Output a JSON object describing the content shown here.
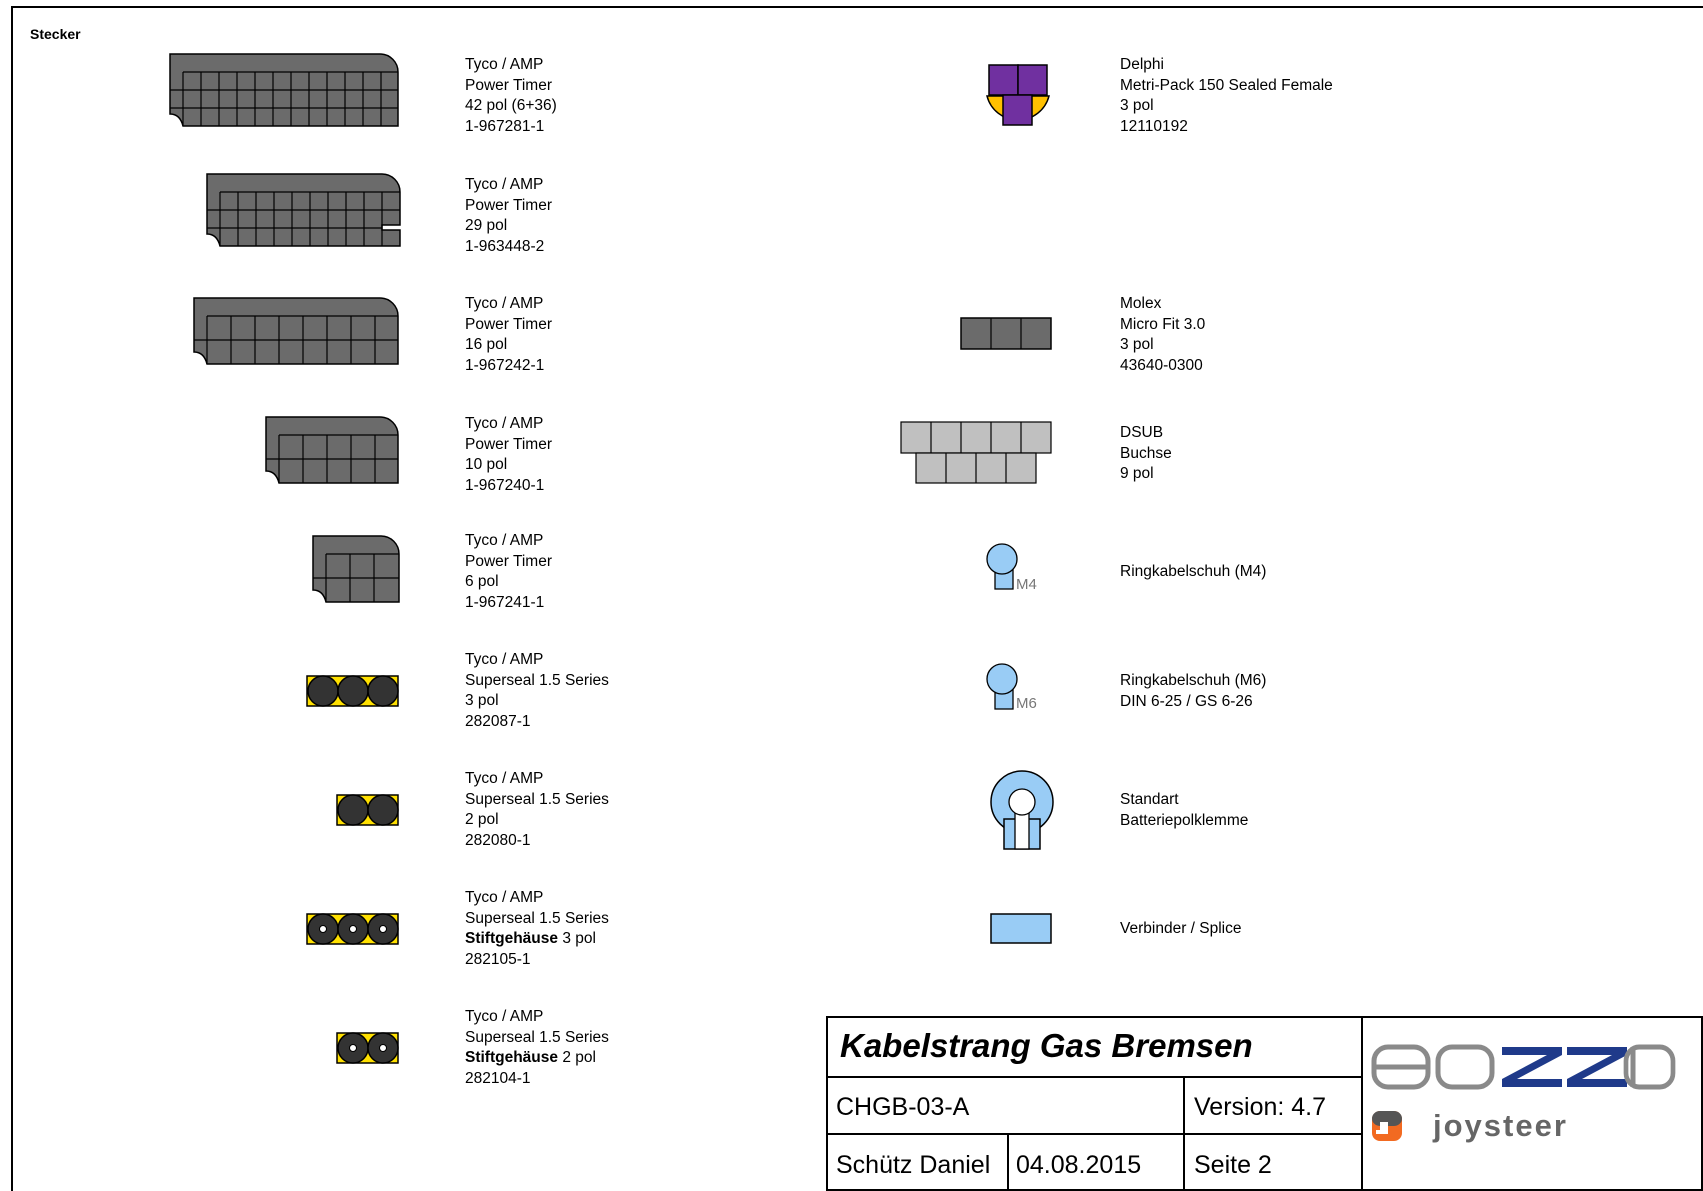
{
  "section_heading": "Stecker",
  "left_items": [
    {
      "icon": "tyco-power-timer-42-pol-connector-icon",
      "lines": [
        "Tyco / AMP",
        "Power Timer",
        "42 pol (6+36)",
        "1-967281-1"
      ]
    },
    {
      "icon": "tyco-power-timer-29-pol-connector-icon",
      "lines": [
        "Tyco / AMP",
        "Power Timer",
        "29 pol",
        "1-963448-2"
      ]
    },
    {
      "icon": "tyco-power-timer-16-pol-connector-icon",
      "lines": [
        "Tyco / AMP",
        "Power Timer",
        "16 pol",
        "1-967242-1"
      ]
    },
    {
      "icon": "tyco-power-timer-10-pol-connector-icon",
      "lines": [
        "Tyco / AMP",
        "Power Timer",
        "10 pol",
        "1-967240-1"
      ]
    },
    {
      "icon": "tyco-power-timer-6-pol-connector-icon",
      "lines": [
        "Tyco / AMP",
        "Power Timer",
        "6 pol",
        "1-967241-1"
      ]
    },
    {
      "icon": "superseal-3-pol-connector-icon",
      "lines": [
        "Tyco / AMP",
        "Superseal 1.5 Series",
        "3 pol",
        "282087-1"
      ]
    },
    {
      "icon": "superseal-2-pol-connector-icon",
      "lines": [
        "Tyco / AMP",
        "Superseal 1.5 Series",
        "2 pol",
        "282080-1"
      ]
    },
    {
      "icon": "superseal-stift-3-pol-connector-icon",
      "lines": [
        "Tyco / AMP",
        "Superseal 1.5 Series"
      ],
      "bold_line": {
        "bold": "Stiftgehäuse",
        "rest": " 3 pol"
      },
      "last": "282105-1"
    },
    {
      "icon": "superseal-stift-2-pol-connector-icon",
      "lines": [
        "Tyco / AMP",
        "Superseal 1.5 Series"
      ],
      "bold_line": {
        "bold": "Stiftgehäuse",
        "rest": " 2 pol"
      },
      "last": "282104-1"
    }
  ],
  "right_items": [
    {
      "icon": "delphi-metri-pack-connector-icon",
      "lines": [
        "Delphi",
        "Metri-Pack 150 Sealed Female",
        "3 pol",
        "12110192"
      ]
    },
    {
      "icon": "molex-micro-fit-connector-icon",
      "lines": [
        "Molex",
        "Micro Fit 3.0",
        "3 pol",
        "43640-0300"
      ]
    },
    {
      "icon": "dsub-connector-icon",
      "lines": [
        "DSUB",
        "Buchse",
        "9 pol"
      ]
    },
    {
      "icon": "ring-terminal-m4-icon",
      "lines": [
        "Ringkabelschuh (M4)"
      ],
      "badge": "M4"
    },
    {
      "icon": "ring-terminal-m6-icon",
      "lines": [
        "Ringkabelschuh (M6)",
        "DIN 6-25 / GS 6-26"
      ],
      "badge": "M6"
    },
    {
      "icon": "battery-clamp-icon",
      "lines": [
        "Standart",
        "Batteriepolklemme"
      ]
    },
    {
      "icon": "splice-icon",
      "lines": [
        "Verbinder / Splice"
      ]
    }
  ],
  "title_block": {
    "title": "Kabelstrang Gas Bremsen",
    "drawing_number": "CHGB-03-A",
    "version": "Version: 4.7",
    "author": "Schütz Daniel",
    "date": "04.08.2015",
    "page": "Seite 2",
    "logo_top": "BOZZIO",
    "logo_bottom": "joysteer"
  },
  "colors": {
    "connector_gray": "#6b6b6b",
    "dsub_gray": "#c0c0c0",
    "superseal_yellow": "#ffe000",
    "terminal_blue": "#99ccf5",
    "delphi_purple": "#7030a0",
    "delphi_orange": "#ffc000",
    "logo_navy": "#1f3a8a",
    "logo_orange": "#f26a21",
    "logo_gray": "#8a8a8a"
  }
}
